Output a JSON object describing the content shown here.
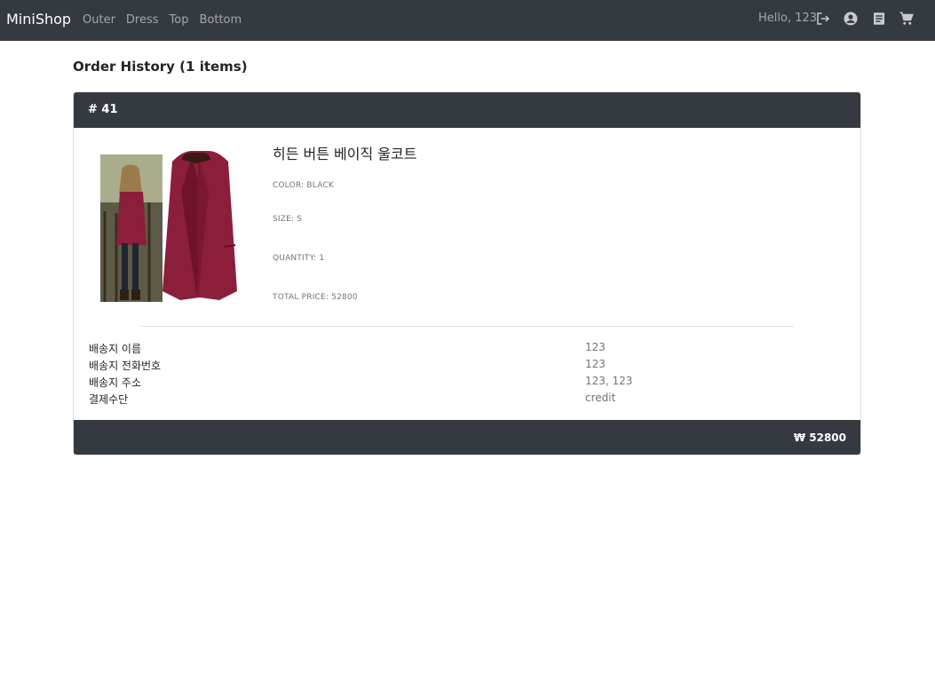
{
  "nav": {
    "brand": "MiniShop",
    "links": [
      "Outer",
      "Dress",
      "Top",
      "Bottom"
    ],
    "greeting": "Hello, 123",
    "icons": [
      "logout-icon",
      "account-icon",
      "orders-icon",
      "cart-icon"
    ]
  },
  "page": {
    "title": "Order History (1 items)"
  },
  "order": {
    "number": "# 41",
    "product": {
      "name": "히든 버튼 베이직 울코트",
      "color": "COLOR: BLACK",
      "size": "SIZE: S",
      "quantity": "QUANTITY: 1",
      "total_price": "TOTAL PRICE: 52800"
    },
    "shipping": [
      {
        "label": "배송지 이름",
        "value": "123"
      },
      {
        "label": "배송지 전화번호",
        "value": "123"
      },
      {
        "label": "배송지 주소",
        "value": "123, 123"
      },
      {
        "label": "결제수단",
        "value": "credit"
      }
    ],
    "total": "₩ 52800"
  },
  "colors": {
    "navbar": "#343a40",
    "coat": "#8b1e3a"
  }
}
